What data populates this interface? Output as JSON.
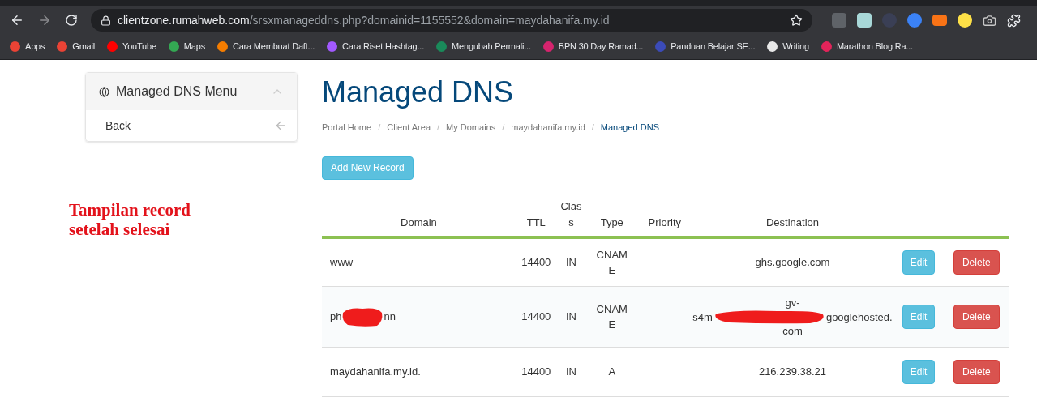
{
  "browser": {
    "url_host": "clientzone.rumahweb.com",
    "url_path": "/srsxmanageddns.php?domainid=1155552&domain=maydahanifa.my.id",
    "bookmarks": [
      {
        "label": "Apps",
        "color": "#ea4335"
      },
      {
        "label": "Gmail",
        "color": "#ea4335"
      },
      {
        "label": "YouTube",
        "color": "#ff0000"
      },
      {
        "label": "Maps",
        "color": "#34a853"
      },
      {
        "label": "Cara Membuat Daft...",
        "color": "#f57d00"
      },
      {
        "label": "Cara Riset Hashtag...",
        "color": "#a259ff"
      },
      {
        "label": "Mengubah Permali...",
        "color": "#1a8a5a"
      },
      {
        "label": "BPN 30 Day Ramad...",
        "color": "#d6246e"
      },
      {
        "label": "Panduan Belajar SE...",
        "color": "#3b4bb8"
      },
      {
        "label": "Writing",
        "color": "#e8e8e8"
      },
      {
        "label": "Marathon Blog Ra...",
        "color": "#e2245a"
      }
    ]
  },
  "sidebar": {
    "title": "Managed DNS Menu",
    "expanded": true,
    "items": [
      {
        "label": "Back"
      }
    ]
  },
  "annotation": [
    "Tampilan record",
    "setelah selesai"
  ],
  "page": {
    "title": "Managed DNS",
    "breadcrumb": [
      {
        "label": "Portal Home",
        "selected": false
      },
      {
        "label": "Client Area",
        "selected": false
      },
      {
        "label": "My Domains",
        "selected": false
      },
      {
        "label": "maydahanifa.my.id",
        "selected": false
      },
      {
        "label": "Managed DNS",
        "selected": true
      }
    ],
    "separator": "/",
    "add_button": "Add New Record"
  },
  "table": {
    "columns": [
      "Domain",
      "TTL",
      "Class",
      "Type",
      "Priority",
      "Destination"
    ],
    "rows": [
      {
        "domain": [
          "www"
        ],
        "ttl": "14400",
        "class": "IN",
        "type": "CNAME",
        "destination": [
          "ghs.google.com"
        ],
        "redacted": false,
        "edit": "Edit",
        "delete": "Delete"
      },
      {
        "domain": [
          "ph",
          "nn"
        ],
        "ttl": "14400",
        "class": "IN",
        "type": "CNAME",
        "destination": [
          "gv-",
          "s4m",
          "googlehosted.",
          "com"
        ],
        "redacted": true,
        "edit": "Edit",
        "delete": "Delete"
      },
      {
        "domain": [
          "maydahanifa.my.id."
        ],
        "ttl": "14400",
        "class": "IN",
        "type": "A",
        "destination": [
          "216.239.38.21"
        ],
        "redacted": false,
        "edit": "Edit",
        "delete": "Delete"
      }
    ]
  }
}
